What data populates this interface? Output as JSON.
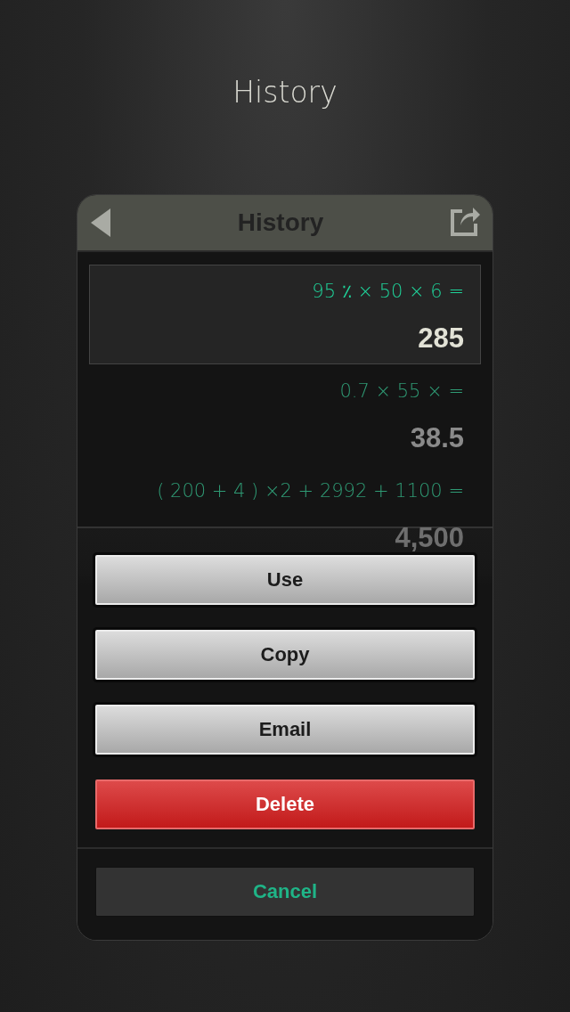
{
  "screen_title": "History",
  "panel": {
    "title": "History"
  },
  "entries": [
    {
      "expression": "95 ٪ × 50 × 6 =",
      "result": "285",
      "selected": true
    },
    {
      "expression": "0.7 × 55 × =",
      "result": "38.5",
      "selected": false
    },
    {
      "expression": "( 200 + 4 ) ×2 + 2992 + 1100 =",
      "result": "4,500",
      "selected": false
    }
  ],
  "actions": [
    {
      "label": "Use",
      "kind": "default"
    },
    {
      "label": "Copy",
      "kind": "default"
    },
    {
      "label": "Email",
      "kind": "default"
    },
    {
      "label": "Delete",
      "kind": "destructive"
    },
    {
      "label": "Cancel",
      "kind": "cancel"
    }
  ]
}
